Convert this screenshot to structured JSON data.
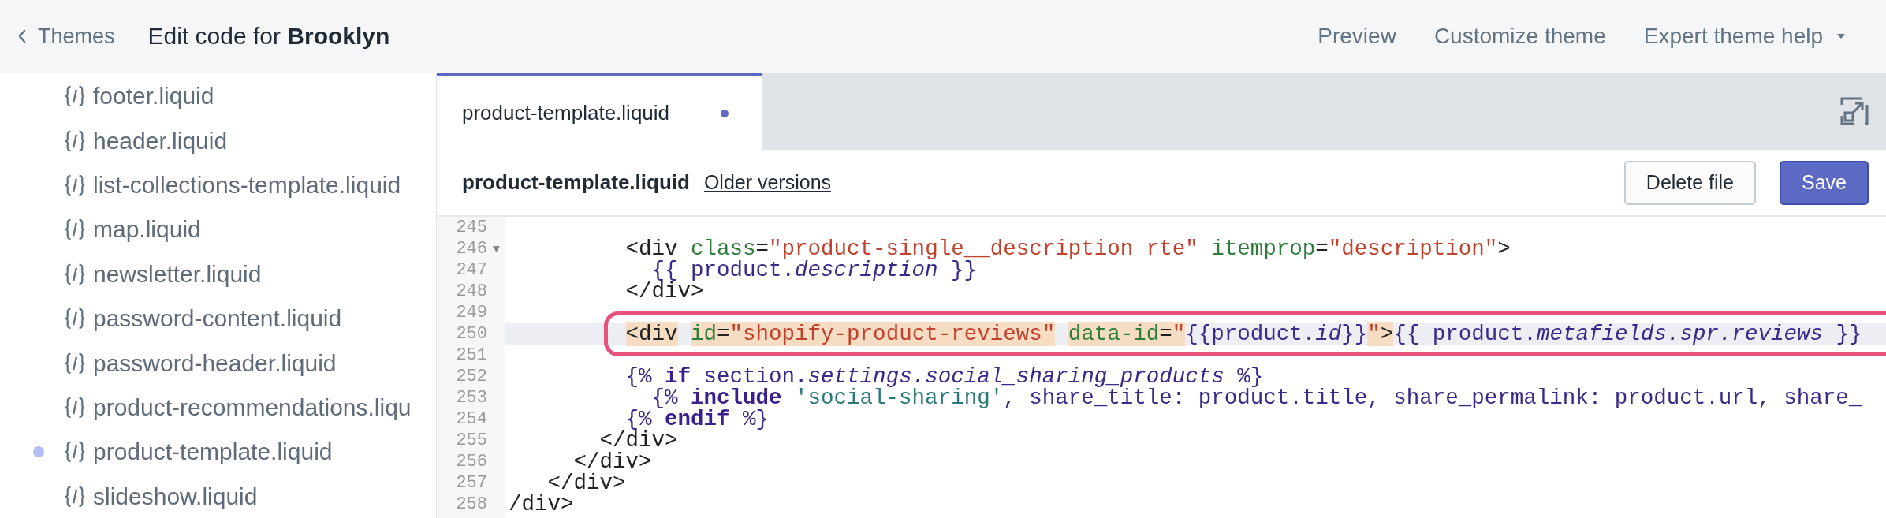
{
  "top_bar": {
    "back": "Themes",
    "title": "Edit code for **Brooklyn**",
    "links": [
      {
        "label": "Preview",
        "dropdown": false
      },
      {
        "label": "Customize theme",
        "dropdown": false
      },
      {
        "label": "Expert theme help",
        "dropdown": true
      }
    ]
  },
  "sidebar": {
    "items": [
      {
        "label": "footer.liquid",
        "modified": false
      },
      {
        "label": "header.liquid",
        "modified": false
      },
      {
        "label": "list-collections-template.liquid",
        "modified": false
      },
      {
        "label": "map.liquid",
        "modified": false
      },
      {
        "label": "newsletter.liquid",
        "modified": false
      },
      {
        "label": "password-content.liquid",
        "modified": false
      },
      {
        "label": "password-header.liquid",
        "modified": false
      },
      {
        "label": "product-recommendations.liqu",
        "modified": false
      },
      {
        "label": "product-template.liquid",
        "modified": true
      },
      {
        "label": "slideshow.liquid",
        "modified": false
      }
    ]
  },
  "tabs": [
    {
      "label": "product-template.liquid",
      "selected": true,
      "modified": true
    }
  ],
  "file_header": {
    "filename": "product-template.liquid",
    "link": "Older versions",
    "buttons": [
      {
        "label": "Delete file",
        "kind": "secondary"
      },
      {
        "label": "Save",
        "kind": "primary"
      }
    ]
  },
  "code": {
    "lines": [
      {
        "number": "245",
        "fold": false,
        "active": false,
        "circled": false
      },
      {
        "number": "246",
        "fold": true,
        "active": false,
        "circled": false,
        "tokens": [
          {
            "text": "         <div",
            "kind": "tag"
          },
          {
            "text": " class",
            "kind": "attr"
          },
          {
            "text": "=",
            "kind": "plain"
          },
          {
            "text": "\"product-single__description rte\"",
            "kind": "str"
          },
          {
            "text": " itemprop",
            "kind": "attr"
          },
          {
            "text": "=",
            "kind": "plain"
          },
          {
            "text": "\"description\"",
            "kind": "str"
          },
          {
            "text": ">",
            "kind": "tag"
          }
        ]
      },
      {
        "number": "247",
        "fold": false,
        "active": false,
        "circled": false,
        "tokens": [
          {
            "text": "           {{ product.",
            "kind": "var"
          },
          {
            "text": "description",
            "kind": "vari"
          },
          {
            "text": " }}",
            "kind": "var"
          }
        ]
      },
      {
        "number": "248",
        "fold": false,
        "active": false,
        "circled": false,
        "tokens": [
          {
            "text": "         </div>",
            "kind": "tag"
          }
        ]
      },
      {
        "number": "249",
        "fold": false,
        "active": false,
        "circled": false
      },
      {
        "number": "250",
        "fold": false,
        "active": true,
        "circled": true,
        "tokens": [
          {
            "text": "         <div",
            "kind": "tag",
            "matched": true
          },
          {
            "text": " id",
            "kind": "attr",
            "matched": true
          },
          {
            "text": "=",
            "kind": "plain",
            "matched": true
          },
          {
            "text": "\"shopify-product-reviews\"",
            "kind": "str",
            "matched": true
          },
          {
            "text": " data-id",
            "kind": "attr",
            "matched": true
          },
          {
            "text": "=",
            "kind": "plain",
            "matched": true
          },
          {
            "text": "\"",
            "kind": "str",
            "matched": true
          },
          {
            "text": "{{product.",
            "kind": "var",
            "matched": false
          },
          {
            "text": "id",
            "kind": "vari",
            "matched": false
          },
          {
            "text": "}}",
            "kind": "var",
            "matched": false
          },
          {
            "text": "\"",
            "kind": "str",
            "matched": true
          },
          {
            "text": ">",
            "kind": "tag",
            "matched": true
          },
          {
            "text": "{{ product.",
            "kind": "var",
            "matched": false
          },
          {
            "text": "metafields.spr.reviews",
            "kind": "vari",
            "matched": false
          },
          {
            "text": " }}",
            "kind": "var",
            "matched": false
          }
        ]
      },
      {
        "number": "251",
        "fold": false,
        "active": false,
        "circled": false
      },
      {
        "number": "252",
        "fold": false,
        "active": false,
        "circled": false,
        "tokens": [
          {
            "text": "         {% ",
            "kind": "var"
          },
          {
            "text": "if",
            "kind": "kw"
          },
          {
            "text": " section.",
            "kind": "var"
          },
          {
            "text": "settings.social_sharing_products",
            "kind": "vari"
          },
          {
            "text": " %}",
            "kind": "var"
          }
        ]
      },
      {
        "number": "253",
        "fold": false,
        "active": false,
        "circled": false,
        "tokens": [
          {
            "text": "           {% ",
            "kind": "var"
          },
          {
            "text": "include",
            "kind": "kw"
          },
          {
            "text": " 'social-sharing'",
            "kind": "str2"
          },
          {
            "text": ", share_title: product.title, share_permalink: product.url, share_",
            "kind": "var"
          }
        ]
      },
      {
        "number": "254",
        "fold": false,
        "active": false,
        "circled": false,
        "tokens": [
          {
            "text": "         {% ",
            "kind": "var"
          },
          {
            "text": "endif",
            "kind": "kw"
          },
          {
            "text": " %}",
            "kind": "var"
          }
        ]
      },
      {
        "number": "255",
        "fold": false,
        "active": false,
        "circled": false,
        "tokens": [
          {
            "text": "       </div>",
            "kind": "tag"
          }
        ]
      },
      {
        "number": "256",
        "fold": false,
        "active": false,
        "circled": false,
        "tokens": [
          {
            "text": "     </div>",
            "kind": "tag"
          }
        ]
      },
      {
        "number": "257",
        "fold": false,
        "active": false,
        "circled": false,
        "tokens": [
          {
            "text": "   </div>",
            "kind": "tag"
          }
        ]
      },
      {
        "number": "258",
        "fold": false,
        "active": false,
        "circled": false,
        "tokens": [
          {
            "text": "/div>",
            "kind": "tag"
          }
        ]
      }
    ]
  }
}
